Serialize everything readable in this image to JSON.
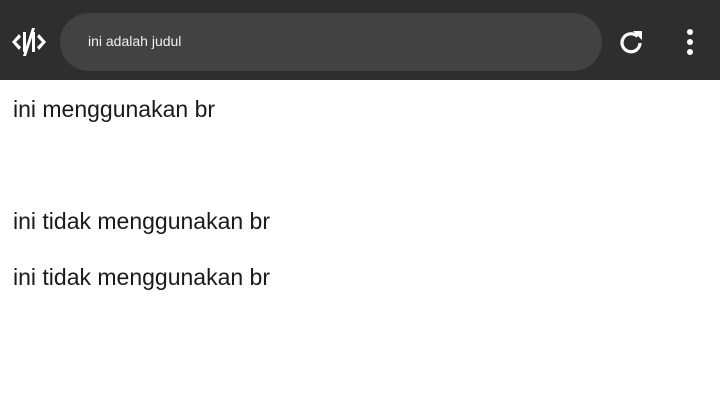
{
  "toolbar": {
    "logo_icon": "code-slash-logo-icon",
    "address_text": "ini adalah judul",
    "reload_icon": "reload-icon",
    "menu_icon": "more-vertical-icon"
  },
  "content": {
    "lines": [
      "ini menggunakan br",
      "ini tidak menggunakan br",
      "ini tidak menggunakan br"
    ]
  },
  "colors": {
    "toolbar_bg": "#2e2e2e",
    "address_bg": "#424242",
    "icon_fg": "#ffffff",
    "page_bg": "#ffffff",
    "text": "#1a1a1a"
  }
}
